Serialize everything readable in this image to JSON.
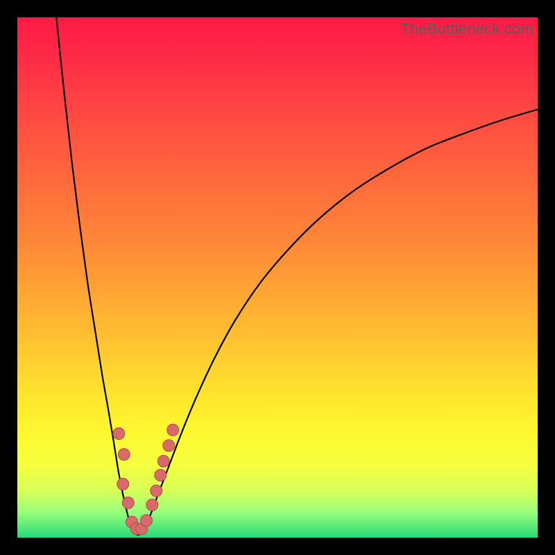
{
  "watermark": "TheBottleneck.com",
  "colors": {
    "gradient_top": "#ff1946",
    "gradient_mid": "#ffd531",
    "gradient_bottom": "#28d97a",
    "curve": "#000000",
    "marker_fill": "#d86a6a",
    "marker_stroke": "#b14d4d",
    "frame_bg": "#000000"
  },
  "chart_data": {
    "type": "line",
    "title": "",
    "xlabel": "",
    "ylabel": "",
    "xlim": [
      0,
      100
    ],
    "ylim": [
      0,
      100
    ],
    "note": "Values in percent of plot area (0 = left/top, 100 = right/bottom). Y inverted for plotting; lower y = visually higher.",
    "series": [
      {
        "name": "left-branch",
        "x": [
          7.5,
          9.0,
          10.5,
          12.0,
          13.5,
          15.0,
          16.3,
          17.5,
          18.5,
          19.3,
          20.0,
          20.7,
          21.3,
          21.9
        ],
        "y": [
          0.0,
          14.5,
          28.0,
          40.0,
          51.0,
          60.5,
          68.7,
          75.5,
          81.5,
          86.5,
          90.3,
          93.5,
          96.0,
          98.0
        ]
      },
      {
        "name": "valley",
        "x": [
          21.9,
          22.7,
          23.6,
          24.6
        ],
        "y": [
          98.0,
          99.3,
          99.3,
          98.0
        ]
      },
      {
        "name": "right-branch",
        "x": [
          24.6,
          25.7,
          27.2,
          29.1,
          31.5,
          34.4,
          38.0,
          42.0,
          46.7,
          52.0,
          58.0,
          64.7,
          72.0,
          79.0,
          86.7,
          93.3,
          100.0
        ],
        "y": [
          98.0,
          95.3,
          91.3,
          86.3,
          80.0,
          73.0,
          65.3,
          58.0,
          51.0,
          44.7,
          38.7,
          33.3,
          28.7,
          25.0,
          22.0,
          19.7,
          17.7
        ]
      }
    ],
    "markers": [
      {
        "x": 19.5,
        "y": 80.0
      },
      {
        "x": 20.5,
        "y": 84.0
      },
      {
        "x": 20.3,
        "y": 89.7
      },
      {
        "x": 21.3,
        "y": 93.3
      },
      {
        "x": 22.0,
        "y": 97.0
      },
      {
        "x": 22.9,
        "y": 98.3
      },
      {
        "x": 23.9,
        "y": 98.3
      },
      {
        "x": 24.8,
        "y": 96.7
      },
      {
        "x": 25.9,
        "y": 93.7
      },
      {
        "x": 26.7,
        "y": 91.0
      },
      {
        "x": 27.5,
        "y": 88.0
      },
      {
        "x": 28.1,
        "y": 85.3
      },
      {
        "x": 29.1,
        "y": 82.3
      },
      {
        "x": 29.9,
        "y": 79.3
      }
    ]
  }
}
